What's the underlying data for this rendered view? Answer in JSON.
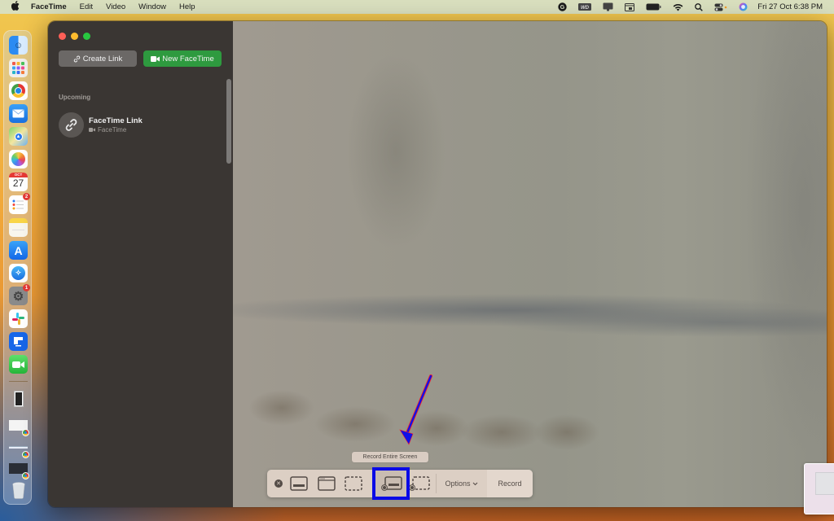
{
  "menubar": {
    "apple_icon": "apple-logo",
    "app_name": "FaceTime",
    "menus": [
      "Edit",
      "Video",
      "Window",
      "Help"
    ],
    "status_icons": [
      "grammarly-icon",
      "wd-drive-icon",
      "display-icon",
      "screen-mirroring-icon",
      "battery-icon",
      "wifi-icon",
      "search-icon",
      "control-center-icon",
      "siri-icon"
    ],
    "clock": "Fri 27 Oct  6:38 PM"
  },
  "dock": {
    "items": [
      {
        "name": "Finder",
        "icon": "finder-icon"
      },
      {
        "name": "Launchpad",
        "icon": "launchpad-icon"
      },
      {
        "name": "Google Chrome",
        "icon": "chrome-icon"
      },
      {
        "name": "Mail",
        "icon": "mail-icon"
      },
      {
        "name": "Maps",
        "icon": "maps-icon"
      },
      {
        "name": "Photos",
        "icon": "photos-icon"
      },
      {
        "name": "Calendar",
        "icon": "calendar-icon",
        "month": "OCT",
        "day": "27"
      },
      {
        "name": "Reminders",
        "icon": "reminders-icon",
        "badge": "2"
      },
      {
        "name": "Notes",
        "icon": "notes-icon"
      },
      {
        "name": "App Store",
        "icon": "app-store-icon"
      },
      {
        "name": "Safari",
        "icon": "safari-icon"
      },
      {
        "name": "System Settings",
        "icon": "settings-icon",
        "badge": "1"
      },
      {
        "name": "Slack",
        "icon": "slack-icon"
      },
      {
        "name": "Flow",
        "icon": "flow-icon"
      },
      {
        "name": "FaceTime",
        "icon": "facetime-icon"
      }
    ],
    "minimized": [
      {
        "name": "Window 1",
        "icon": "window-thumbnail"
      },
      {
        "name": "Chrome Window 1",
        "icon": "chrome-window-thumbnail"
      },
      {
        "name": "Chrome Window 2",
        "icon": "chrome-window-thumbnail"
      },
      {
        "name": "Chrome Window 3",
        "icon": "chrome-window-thumbnail"
      }
    ],
    "trash": {
      "name": "Trash",
      "icon": "trash-icon"
    }
  },
  "facetime": {
    "create_link_label": "Create Link",
    "new_facetime_label": "New FaceTime",
    "section_label": "Upcoming",
    "items": [
      {
        "title": "FaceTime Link",
        "subtitle": "FaceTime"
      }
    ]
  },
  "capture_toolbar": {
    "tooltip": "Record Entire Screen",
    "tools": [
      {
        "name": "Capture Entire Screen",
        "icon": "capture-screen-icon"
      },
      {
        "name": "Capture Selected Window",
        "icon": "capture-window-icon"
      },
      {
        "name": "Capture Selected Portion",
        "icon": "capture-portion-icon"
      },
      {
        "name": "Record Entire Screen",
        "icon": "record-screen-icon",
        "selected": true
      },
      {
        "name": "Record Selected Portion",
        "icon": "record-portion-icon"
      }
    ],
    "options_label": "Options",
    "record_label": "Record"
  },
  "colors": {
    "accent_green": "#2e9a3f",
    "annotation_blue": "#0a0ae6"
  }
}
